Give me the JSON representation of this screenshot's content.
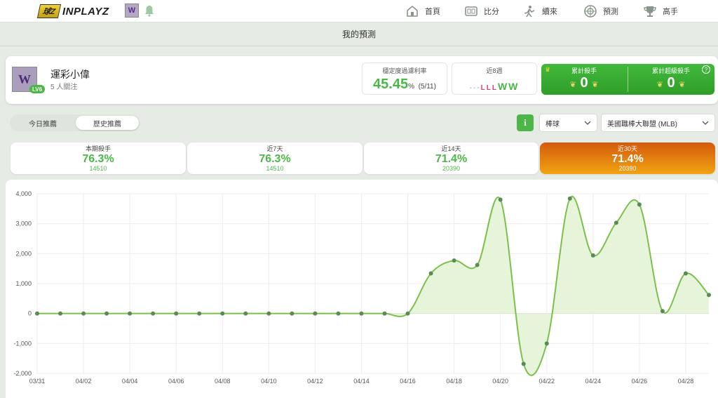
{
  "brand": {
    "logo_badge": "球Z",
    "logo_text": "INPLAYZ",
    "avatar_letter": "W"
  },
  "nav": [
    {
      "label": "首頁",
      "icon": "home-icon"
    },
    {
      "label": "比分",
      "icon": "scoreboard-icon"
    },
    {
      "label": "續來",
      "icon": "player-icon"
    },
    {
      "label": "預測",
      "icon": "target-icon"
    },
    {
      "label": "高手",
      "icon": "trophy-icon"
    }
  ],
  "page_title": "我的預測",
  "profile": {
    "name": "運彩小偉",
    "followers": "5 人關注",
    "level": "LV6",
    "avatar_letter": "W",
    "stability_label": "穩定度過濾利率",
    "stability_value": "45.45",
    "stability_unit": "%",
    "stability_detail": "(5/11)",
    "recent_label": "近8週",
    "recent_form_dashes": "---",
    "recent_form_losses": "LLL",
    "recent_form_wins": "WW",
    "award1_label": "累計殺手",
    "award1_value": "0",
    "award2_label": "累計超級殺手",
    "award2_value": "0",
    "help_symbol": "?"
  },
  "tabs": {
    "today": "今日推薦",
    "history": "歷史推薦"
  },
  "filters": {
    "info": "i",
    "sport": "棒球",
    "league": "美國職棒大聯盟 (MLB)"
  },
  "periods": [
    {
      "label": "本期殺手",
      "value": "76.3%",
      "count": "14510"
    },
    {
      "label": "近7天",
      "value": "76.3%",
      "count": "14510"
    },
    {
      "label": "近14天",
      "value": "71.4%",
      "count": "20390"
    },
    {
      "label": "近30天",
      "value": "71.4%",
      "count": "20390"
    }
  ],
  "chart_data": {
    "type": "area",
    "x": [
      "03/31",
      "04/01",
      "04/02",
      "04/03",
      "04/04",
      "04/05",
      "04/06",
      "04/07",
      "04/08",
      "04/09",
      "04/10",
      "04/11",
      "04/12",
      "04/13",
      "04/14",
      "04/15",
      "04/16",
      "04/17",
      "04/18",
      "04/19",
      "04/20",
      "04/21",
      "04/22",
      "04/23",
      "04/24",
      "04/25",
      "04/26",
      "04/27",
      "04/28",
      "04/29"
    ],
    "values": [
      0,
      0,
      0,
      0,
      0,
      0,
      0,
      0,
      0,
      0,
      0,
      0,
      0,
      0,
      0,
      0,
      0,
      1340,
      1770,
      1620,
      3800,
      -1680,
      -1000,
      3840,
      1940,
      3030,
      3640,
      80,
      1340,
      620
    ],
    "x_tick_labels": [
      "03/31",
      "04/02",
      "04/04",
      "04/06",
      "04/08",
      "04/10",
      "04/12",
      "04/14",
      "04/16",
      "04/18",
      "04/20",
      "04/22",
      "04/24",
      "04/26",
      "04/28"
    ],
    "y_ticks": [
      "4,000",
      "3,000",
      "2,000",
      "1,000",
      "0",
      "-1,000",
      "-2,000"
    ],
    "ylim": [
      -2000,
      4000
    ],
    "grid": true,
    "line_color": "#7cc04b",
    "fill_color": "#e6f5d9",
    "point_color": "#5b8a57"
  }
}
